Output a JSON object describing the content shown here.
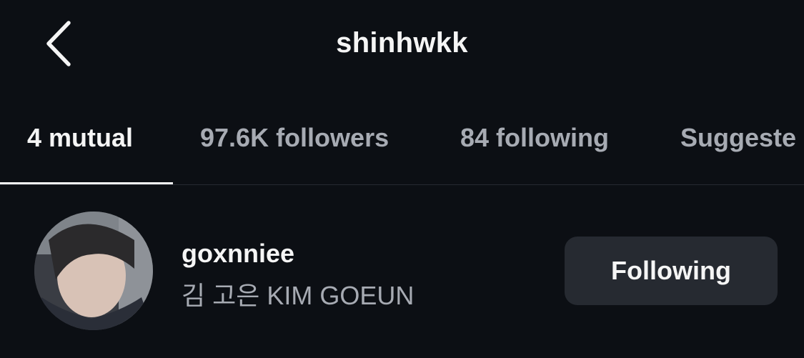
{
  "header": {
    "title": "shinhwkk",
    "back_icon": "chevron-left-icon"
  },
  "tabs": [
    {
      "label": "4 mutual",
      "active": true
    },
    {
      "label": "97.6K followers",
      "active": false
    },
    {
      "label": "84 following",
      "active": false
    },
    {
      "label": "Suggeste",
      "active": false
    }
  ],
  "list": [
    {
      "username": "goxnniee",
      "full_name": "김 고은 KIM GOEUN",
      "button_label": "Following"
    }
  ],
  "colors": {
    "background": "#0c0f14",
    "primary_text": "#f5f5f5",
    "secondary_text": "#a7abb3",
    "button_bg": "#262a31"
  }
}
